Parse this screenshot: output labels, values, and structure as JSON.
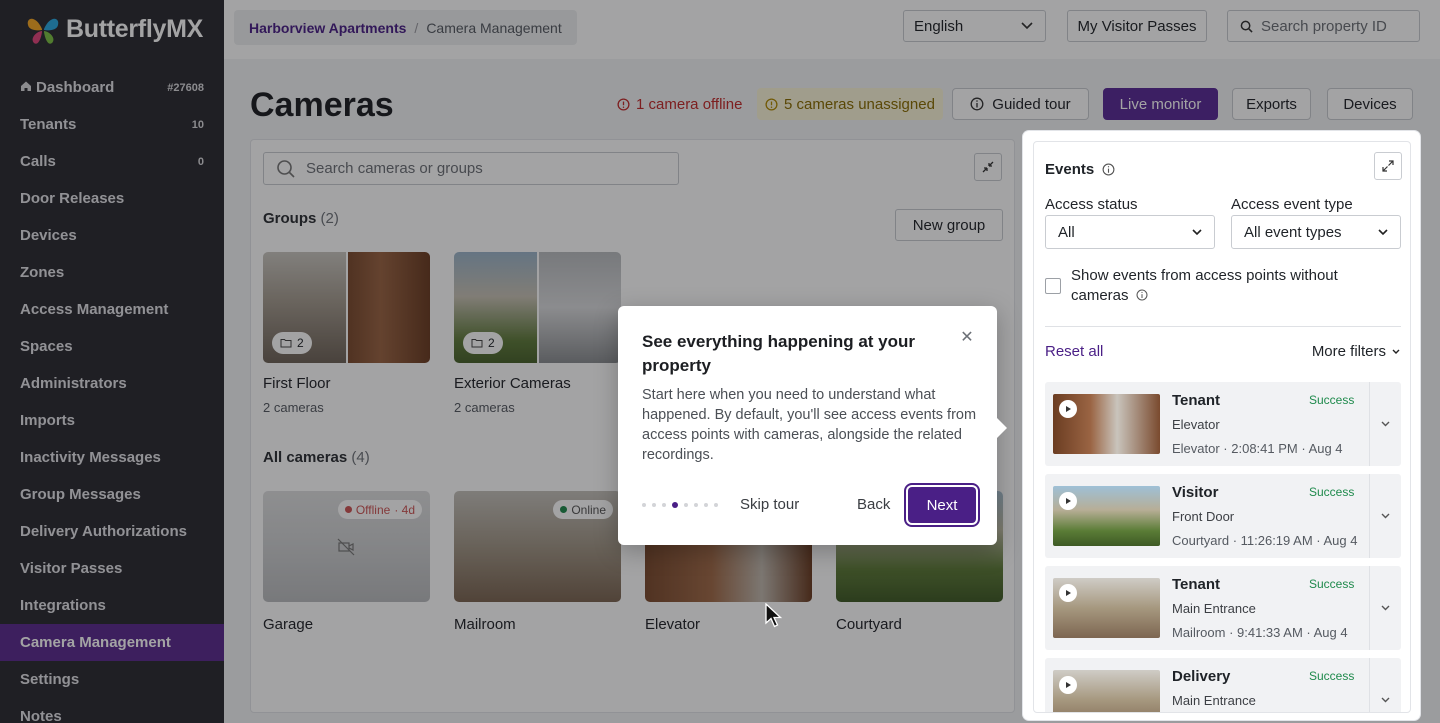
{
  "brand": {
    "name": "ButterflyMX"
  },
  "sidebar": {
    "items": [
      {
        "label": "Dashboard",
        "count": "#27608",
        "icon": "home-icon"
      },
      {
        "label": "Tenants",
        "count": "10"
      },
      {
        "label": "Calls",
        "count": "0"
      },
      {
        "label": "Door Releases",
        "count": ""
      },
      {
        "label": "Devices",
        "count": ""
      },
      {
        "label": "Zones",
        "count": ""
      },
      {
        "label": "Access Management",
        "count": ""
      },
      {
        "label": "Spaces",
        "count": ""
      },
      {
        "label": "Administrators",
        "count": ""
      },
      {
        "label": "Imports",
        "count": ""
      },
      {
        "label": "Inactivity Messages",
        "count": ""
      },
      {
        "label": "Group Messages",
        "count": ""
      },
      {
        "label": "Delivery Authorizations",
        "count": ""
      },
      {
        "label": "Visitor Passes",
        "count": ""
      },
      {
        "label": "Integrations",
        "count": ""
      },
      {
        "label": "Camera Management",
        "count": "",
        "active": true
      },
      {
        "label": "Settings",
        "count": ""
      },
      {
        "label": "Notes",
        "count": ""
      }
    ]
  },
  "topbar": {
    "breadcrumb_link": "Harborview Apartments",
    "breadcrumb_sep": "/",
    "breadcrumb_current": "Camera Management",
    "language": "English",
    "visitor_passes": "My Visitor Passes",
    "search_placeholder": "Search property ID"
  },
  "page": {
    "title": "Cameras",
    "offline_alert": "1 camera offline",
    "unassigned_alert": "5 cameras unassigned",
    "guided_tour": "Guided tour",
    "live_monitor": "Live monitor",
    "exports": "Exports",
    "devices": "Devices"
  },
  "cameras_panel": {
    "search_placeholder": "Search cameras or groups",
    "groups_label": "Groups",
    "groups_count": "(2)",
    "new_group": "New group",
    "groups": [
      {
        "name": "First Floor",
        "sub": "2 cameras",
        "count": "2"
      },
      {
        "name": "Exterior Cameras",
        "sub": "2 cameras",
        "count": "2"
      }
    ],
    "all_label": "All cameras",
    "all_count": "(4)",
    "cameras": [
      {
        "name": "Garage",
        "status": "Offline",
        "status_extra": "· 4d"
      },
      {
        "name": "Mailroom",
        "status": "Online",
        "status_extra": ""
      },
      {
        "name": "Elevator",
        "status": "",
        "status_extra": ""
      },
      {
        "name": "Courtyard",
        "status": "",
        "status_extra": ""
      }
    ]
  },
  "events": {
    "title": "Events",
    "access_status_label": "Access status",
    "access_status_value": "All",
    "event_type_label": "Access event type",
    "event_type_value": "All event types",
    "checkbox_label": "Show events from access points without cameras",
    "reset": "Reset all",
    "more_filters": "More filters",
    "rows": [
      {
        "type": "Tenant",
        "status": "Success",
        "point": "Elevator",
        "meta": "Elevator · 2:08:41 PM · Aug 4"
      },
      {
        "type": "Visitor",
        "status": "Success",
        "point": "Front Door",
        "meta": "Courtyard · 11:26:19 AM · Aug 4"
      },
      {
        "type": "Tenant",
        "status": "Success",
        "point": "Main Entrance",
        "meta": "Mailroom · 9:41:33 AM · Aug 4"
      },
      {
        "type": "Delivery",
        "status": "Success",
        "point": "Main Entrance",
        "meta": ""
      }
    ]
  },
  "tour": {
    "title": "See everything happening at your property",
    "body": "Start here when you need to understand what happened. By default, you'll see access events from access points with cameras, alongside the related recordings.",
    "skip": "Skip tour",
    "back": "Back",
    "next": "Next",
    "step": 4,
    "total_steps": 8
  },
  "colors": {
    "brand_purple": "#4a1f86",
    "sidebar_bg": "#2b2a31",
    "active_nav": "#5b2a8f",
    "success": "#1f8a4c",
    "offline": "#c22a2a"
  }
}
